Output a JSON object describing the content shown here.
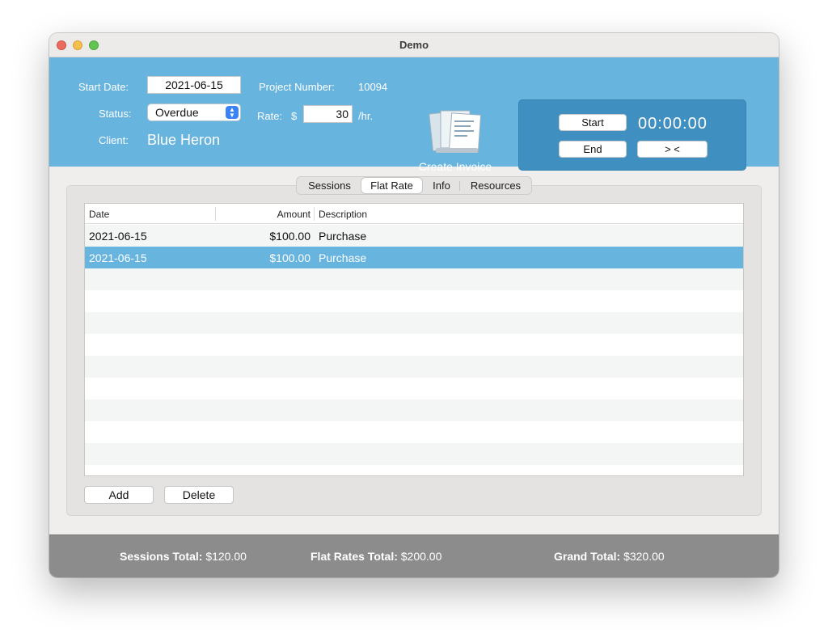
{
  "window": {
    "title": "Demo"
  },
  "header": {
    "start_date_label": "Start Date:",
    "start_date_value": "2021-06-15",
    "status_label": "Status:",
    "status_value": "Overdue",
    "client_label": "Client:",
    "client_value": "Blue Heron",
    "project_number_label": "Project Number:",
    "project_number_value": "10094",
    "rate_label": "Rate:",
    "rate_currency": "$",
    "rate_value": "30",
    "rate_unit": "/hr.",
    "create_invoice_label": "Create Invoice",
    "create_invoice_icon": "invoice-documents-icon"
  },
  "timer": {
    "start_label": "Start",
    "end_label": "End",
    "reset_label": "> <",
    "display": "00:00:00"
  },
  "tabs": [
    {
      "label": "Sessions",
      "active": false
    },
    {
      "label": "Flat Rate",
      "active": true
    },
    {
      "label": "Info",
      "active": false
    },
    {
      "label": "Resources",
      "active": false
    }
  ],
  "table": {
    "columns": [
      "Date",
      "Amount",
      "Description"
    ],
    "rows": [
      {
        "date": "2021-06-15",
        "amount": "$100.00",
        "description": "Purchase",
        "selected": false
      },
      {
        "date": "2021-06-15",
        "amount": "$100.00",
        "description": "Purchase",
        "selected": true
      }
    ]
  },
  "buttons": {
    "add_label": "Add",
    "delete_label": "Delete"
  },
  "footer": {
    "sessions_total_label": "Sessions Total:",
    "sessions_total_value": "$120.00",
    "flat_rates_total_label": "Flat Rates Total:",
    "flat_rates_total_value": "$200.00",
    "grand_total_label": "Grand Total:",
    "grand_total_value": "$320.00"
  },
  "colors": {
    "header_blue": "#67b4de",
    "timer_panel": "#3f8fc0",
    "selection": "#67b4de",
    "footer_gray": "#8c8c8c"
  }
}
